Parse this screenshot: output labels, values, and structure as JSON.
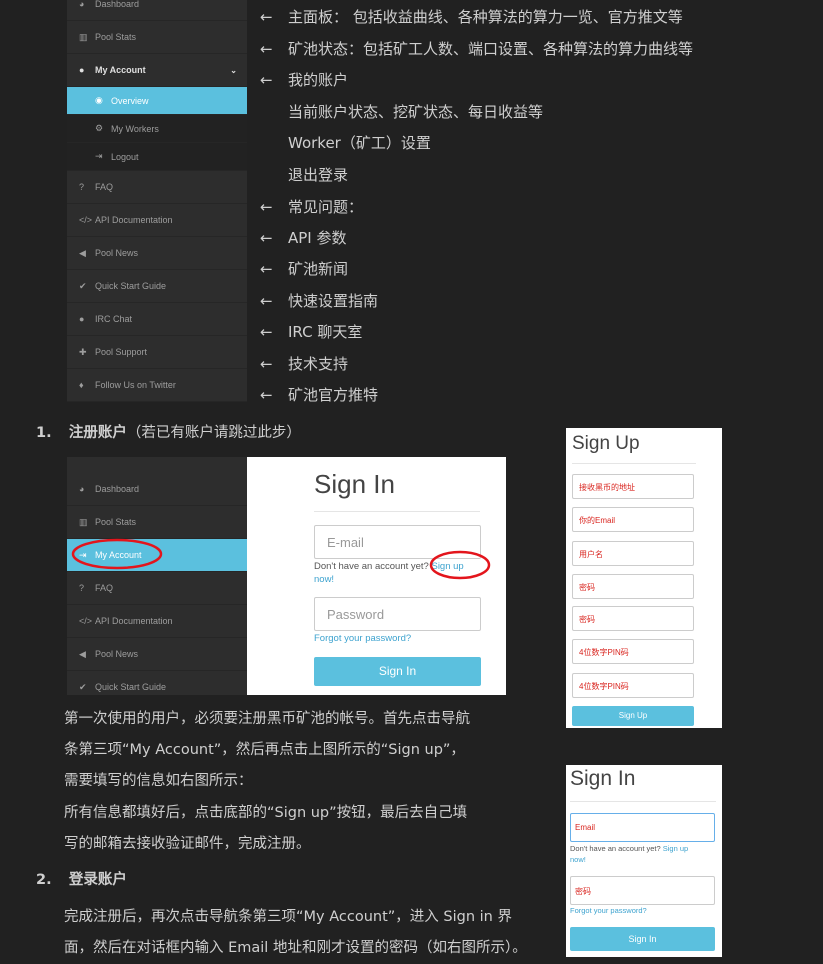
{
  "top_nav": {
    "items": [
      {
        "label": "Dashboard"
      },
      {
        "label": "Pool Stats"
      },
      {
        "label": "My Account"
      },
      {
        "label": "Overview"
      },
      {
        "label": "My Workers"
      },
      {
        "label": "Logout"
      },
      {
        "label": "FAQ"
      },
      {
        "label": "API Documentation"
      },
      {
        "label": "Pool News"
      },
      {
        "label": "Quick Start Guide"
      },
      {
        "label": "IRC Chat"
      },
      {
        "label": "Pool Support"
      },
      {
        "label": "Follow Us on Twitter"
      }
    ]
  },
  "annotations": [
    "主面板：    包括收益曲线、各种算法的算力一览、官方推文等",
    "矿池状态：包括矿工人数、端口设置、各种算法的算力曲线等",
    "我的账户",
    "当前账户状态、挖矿状态、每日收益等",
    "Worker（矿工）设置",
    "退出登录",
    "常见问题：",
    "API 参数",
    "矿池新闻",
    "快速设置指南",
    "IRC 聊天室",
    "技术支持",
    "矿池官方推特"
  ],
  "arrow_glyph": "←",
  "step1": {
    "number": "1.",
    "title": "注册账户",
    "title_note": "（若已有账户请跳过此步）",
    "para1_line1": "第一次使用的用户，必须要注册黑币矿池的帐号。首先点击导航",
    "para1_line2": "条第三项“My Account”，然后再点击上图所示的“Sign up”，",
    "para1_line3": "需要填写的信息如右图所示：",
    "para2_line1": "所有信息都填好后，点击底部的“Sign up”按钮，最后去自己填",
    "para2_line2": "写的邮箱去接收验证邮件，完成注册。"
  },
  "step2": {
    "number": "2.",
    "title": "登录账户",
    "para_line1": "完成注册后，再次点击导航条第三项“My Account”，进入 Sign in 界",
    "para_line2": "面，然后在对话框内输入 Email 地址和刚才设置的密码（如右图所示）。"
  },
  "signin_shot": {
    "nav": [
      {
        "label": "Dashboard"
      },
      {
        "label": "Pool Stats"
      },
      {
        "label": "My Account"
      },
      {
        "label": "FAQ"
      },
      {
        "label": "API Documentation"
      },
      {
        "label": "Pool News"
      },
      {
        "label": "Quick Start Guide"
      }
    ],
    "title": "Sign In",
    "email_placeholder": "E-mail",
    "no_account": "Don't have an account yet?",
    "signup_link": "Sign up",
    "now": "now!",
    "password_placeholder": "Password",
    "forgot": "Forgot your password?",
    "button": "Sign In"
  },
  "signup_shot": {
    "title": "Sign Up",
    "fields": [
      "接收黑币的地址",
      "你的Email",
      "用户名",
      "密码",
      "密码",
      "4位数字PIN码",
      "4位数字PIN码"
    ],
    "button": "Sign Up"
  },
  "signin_small": {
    "title": "Sign In",
    "email": "Email",
    "no_account": "Don't have an account yet?",
    "signup_link": "Sign up",
    "now": "now!",
    "password": "密码",
    "forgot": "Forgot your password?",
    "button": "Sign In"
  },
  "colors": {
    "accent": "#5bc0de",
    "annotation_red": "#d9251f",
    "sidebar": "#2d2d2d",
    "background": "#212121"
  }
}
